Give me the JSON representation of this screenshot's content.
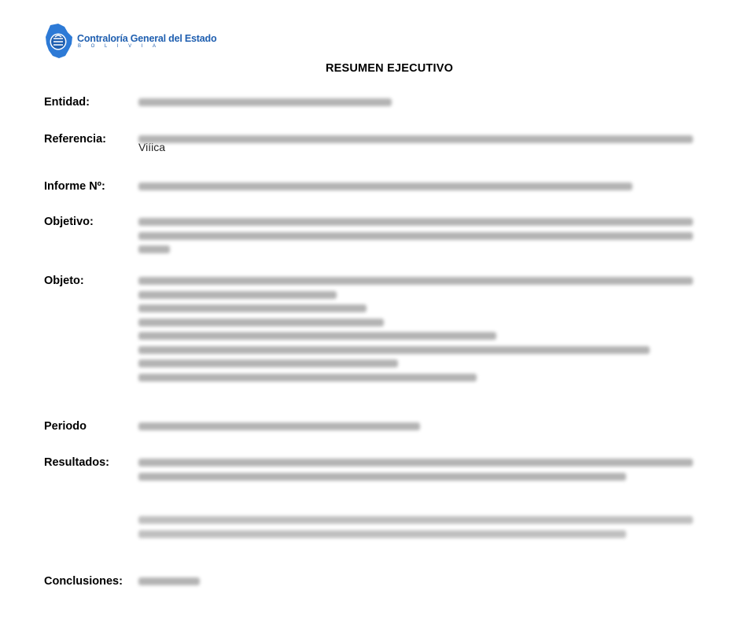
{
  "header": {
    "logo_org": "Contraloría General del Estado",
    "logo_country": "BOLIVIA",
    "logo_colors": {
      "primary": "#1f5fb0",
      "secondary": "#2d7ad6"
    }
  },
  "title": "RESUMEN EJECUTIVO",
  "fields": {
    "entidad_label": "Entidad:",
    "referencia_label": "Referencia:",
    "referencia_tail": "Viíica",
    "informe_label": "Informe Nº:",
    "objetivo_label": "Objetivo:",
    "objeto_label": "Objeto:",
    "periodo_label": "Periodo",
    "resultados_label": "Resultados:",
    "conclusiones_label": "Conclusiones:"
  }
}
